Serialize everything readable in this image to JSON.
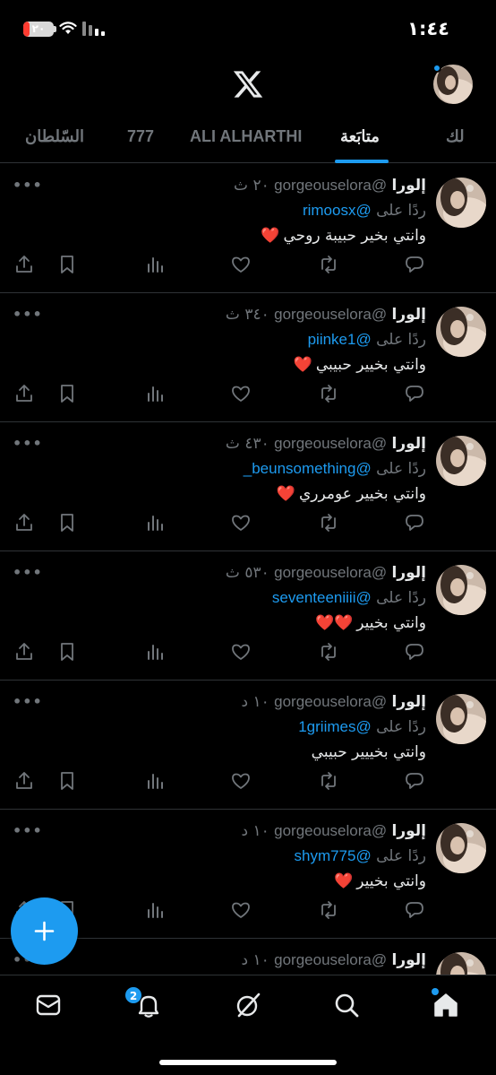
{
  "status_bar": {
    "time": "١:٤٤",
    "battery_level": "٢٠",
    "battery_fraction": 0.2,
    "icons": [
      "battery-icon",
      "wifi-icon",
      "cellular-signal-icon"
    ]
  },
  "header": {
    "logo": "x-logo-icon",
    "profile_avatar": "profile-avatar"
  },
  "tabs": [
    {
      "label": "لك",
      "active": false
    },
    {
      "label": "متابَعة",
      "active": true
    },
    {
      "label": "ALI ALHARTHI",
      "active": false
    },
    {
      "label": "777",
      "active": false
    },
    {
      "label": "السّلطان",
      "active": false
    }
  ],
  "tweets": [
    {
      "name": "إلورا",
      "handle": "@gorgeouselora",
      "time": "٢٠ ث",
      "reply_prefix": "ردًا على",
      "reply_to": "@rimoosx",
      "text": "وانتي بخير حبيبة روحي",
      "hearts": "❤️"
    },
    {
      "name": "إلورا",
      "handle": "@gorgeouselora",
      "time": "٣٤٠ ث",
      "reply_prefix": "ردًا على",
      "reply_to": "@piinke1",
      "text": "وانتي بخيير حبيبي",
      "hearts": "❤️"
    },
    {
      "name": "إلورا",
      "handle": "@gorgeouselora",
      "time": "٤٣٠ ث",
      "reply_prefix": "ردًا على",
      "reply_to": "@beunsomething_",
      "text": "وانتي بخيير عومرري",
      "hearts": "❤️"
    },
    {
      "name": "إلورا",
      "handle": "@gorgeouselora",
      "time": "٥٣٠ ث",
      "reply_prefix": "ردًا على",
      "reply_to": "@seventeeniiii",
      "text": "وانتي بخيير",
      "hearts": "❤️❤️"
    },
    {
      "name": "إلورا",
      "handle": "@gorgeouselora",
      "time": "١٠ د",
      "reply_prefix": "ردًا على",
      "reply_to": "@1griimes",
      "text": "وانتي بخييير حبيبي",
      "hearts": ""
    },
    {
      "name": "إلورا",
      "handle": "@gorgeouselora",
      "time": "١٠ د",
      "reply_prefix": "ردًا على",
      "reply_to": "@shym775",
      "text": "وانتي بخيير",
      "hearts": "❤️"
    },
    {
      "name": "إلورا",
      "handle": "@gorgeouselora",
      "time": "١٠ د",
      "reply_prefix": "",
      "reply_to": "",
      "text": "",
      "hearts": ""
    }
  ],
  "tweet_actions": [
    "reply-icon",
    "retweet-icon",
    "like-icon",
    "views-icon",
    "bookmark-icon",
    "share-icon"
  ],
  "more_label": "•••",
  "fab": {
    "icon": "plus-icon"
  },
  "bottom_nav": {
    "items": [
      "mail-icon",
      "notifications-icon",
      "grok-icon",
      "search-icon",
      "home-icon"
    ],
    "notification_badge": "2"
  },
  "colors": {
    "background": "#000000",
    "accent": "#1d9bf0",
    "text": "#e7e9ea",
    "muted": "#71767b",
    "border": "#2f3336",
    "heart": "#f91880"
  }
}
